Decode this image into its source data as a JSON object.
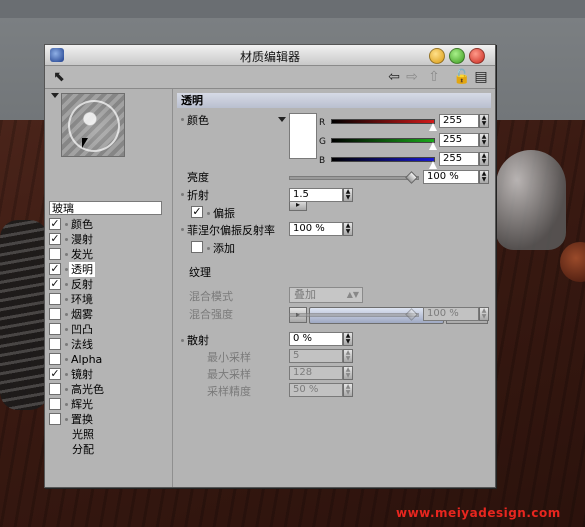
{
  "window": {
    "title": "材质编辑器"
  },
  "material": {
    "name": "玻璃"
  },
  "channels": [
    {
      "label": "颜色",
      "checked": true,
      "check": "✓",
      "selected": false
    },
    {
      "label": "漫射",
      "checked": true,
      "check": "✓",
      "selected": false
    },
    {
      "label": "发光",
      "checked": false,
      "check": "",
      "selected": false
    },
    {
      "label": "透明",
      "checked": true,
      "check": "✓",
      "selected": true
    },
    {
      "label": "反射",
      "checked": true,
      "check": "✓",
      "selected": false
    },
    {
      "label": "环境",
      "checked": false,
      "check": "",
      "selected": false
    },
    {
      "label": "烟雾",
      "checked": false,
      "check": "",
      "selected": false
    },
    {
      "label": "凹凸",
      "checked": false,
      "check": "",
      "selected": false
    },
    {
      "label": "法线",
      "checked": false,
      "check": "",
      "selected": false
    },
    {
      "label": "Alpha",
      "checked": false,
      "check": "",
      "selected": false
    },
    {
      "label": "镜射",
      "checked": true,
      "check": "✓",
      "selected": false
    },
    {
      "label": "高光色",
      "checked": false,
      "check": "",
      "selected": false
    },
    {
      "label": "辉光",
      "checked": false,
      "check": "",
      "selected": false
    },
    {
      "label": "置换",
      "checked": false,
      "check": "",
      "selected": false
    }
  ],
  "extra_items": [
    "光照",
    "分配"
  ],
  "panel": {
    "section_title": "透明",
    "color_label": "颜色",
    "r_label": "R",
    "g_label": "G",
    "b_label": "B",
    "r_value": "255",
    "g_value": "255",
    "b_value": "255",
    "brightness_label": "亮度",
    "brightness_value": "100 %",
    "refraction_label": "折射",
    "refraction_value": "1.5",
    "polarize_label": "偏振",
    "polarize_check": "✓",
    "fresnel_label": "菲涅尔偏振反射率",
    "fresnel_value": "100 %",
    "add_label": "添加",
    "texture_label": "纹理",
    "texture_browse": "...",
    "blend_mode_label": "混合模式",
    "blend_mode_value": "叠加",
    "blend_strength_label": "混合强度",
    "blend_strength_value": "100 %",
    "blur_label": "散射",
    "blur_value": "0 %",
    "min_samples_label": "最小采样",
    "min_samples_value": "5",
    "max_samples_label": "最大采样",
    "max_samples_value": "128",
    "accuracy_label": "采样精度",
    "accuracy_value": "50 %"
  },
  "colors": {
    "r_bar": "#d01a1a",
    "g_bar": "#1aa81a",
    "b_bar": "#1a1ad0",
    "section_header": "#c8cedc",
    "watermark": "#e8261f"
  },
  "watermark": "www.meiyadesign.com"
}
